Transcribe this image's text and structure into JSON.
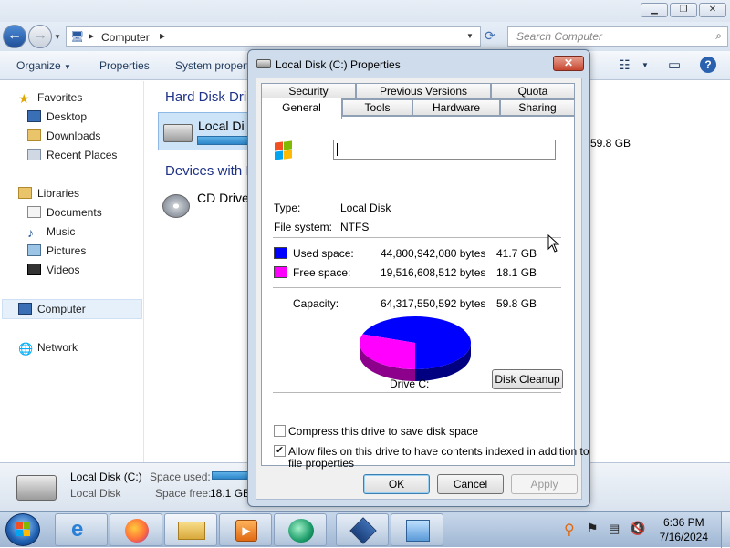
{
  "explorer": {
    "address": {
      "segment": "Computer"
    },
    "search": {
      "placeholder": "Search Computer"
    },
    "toolbar": {
      "organize": "Organize",
      "properties": "Properties",
      "system_properties": "System propert"
    },
    "sidebar": {
      "favorites": "Favorites",
      "favorites_items": [
        "Desktop",
        "Downloads",
        "Recent Places"
      ],
      "libraries": "Libraries",
      "libraries_items": [
        "Documents",
        "Music",
        "Pictures",
        "Videos"
      ],
      "computer": "Computer",
      "network": "Network"
    },
    "content": {
      "group_hard_disk": "Hard Disk Dri",
      "local_disk": "Local Di",
      "local_disk_size": "59.8 GB",
      "group_devices": "Devices with I",
      "cd_drive": "CD Drive"
    },
    "details": {
      "name": "Local Disk (C:)",
      "type": "Local Disk",
      "space_used_label": "Space used:",
      "space_free_label": "Space free:",
      "space_free_value": "18.1 GB"
    }
  },
  "dialog": {
    "title": "Local Disk (C:) Properties",
    "tabs_top": [
      "Security",
      "Previous Versions",
      "Quota"
    ],
    "tabs_bottom": [
      "General",
      "Tools",
      "Hardware",
      "Sharing"
    ],
    "name_value": "",
    "type_label": "Type:",
    "type_value": "Local Disk",
    "fs_label": "File system:",
    "fs_value": "NTFS",
    "used_label": "Used space:",
    "used_bytes": "44,800,942,080 bytes",
    "used_gb": "41.7 GB",
    "free_label": "Free space:",
    "free_bytes": "19,516,608,512 bytes",
    "free_gb": "18.1 GB",
    "capacity_label": "Capacity:",
    "capacity_bytes": "64,317,550,592 bytes",
    "capacity_gb": "59.8 GB",
    "drive_label": "Drive C:",
    "disk_cleanup": "Disk Cleanup",
    "compress_label": "Compress this drive to save disk space",
    "compress_checked": false,
    "index_label_1": "Allow files on this drive to have contents indexed in addition to",
    "index_label_2": "file properties",
    "index_checked": true,
    "ok": "OK",
    "cancel": "Cancel",
    "apply": "Apply",
    "used_fraction": 0.697,
    "colors": {
      "used": "#0000ff",
      "free": "#ff00ff"
    }
  },
  "taskbar": {
    "time": "6:36 PM",
    "date": "7/16/2024",
    "apps": [
      "start-orb",
      "internet-explorer",
      "firefox",
      "windows-explorer",
      "media-player",
      "app-green",
      "virtualbox",
      "control-panel"
    ]
  }
}
